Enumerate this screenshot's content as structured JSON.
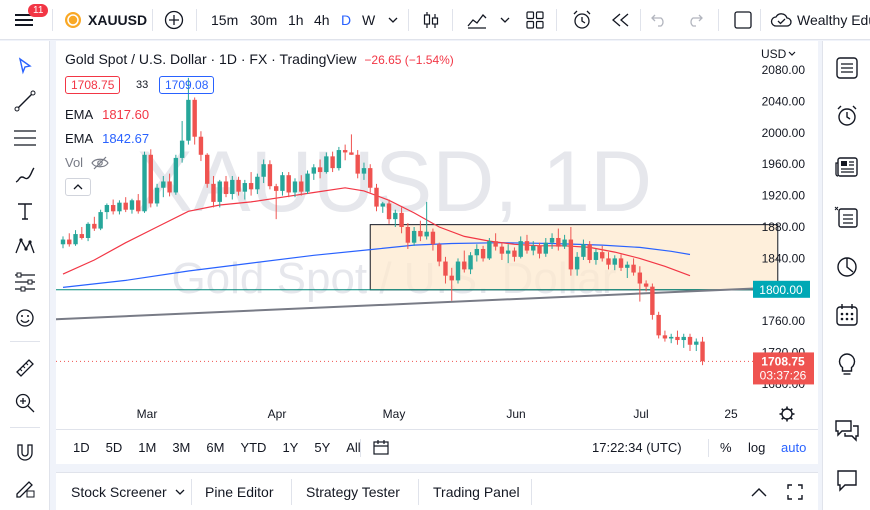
{
  "topbar": {
    "notification_count": "11",
    "symbol": "XAUUSD",
    "intervals": [
      "15m",
      "30m",
      "1h",
      "4h",
      "D",
      "W"
    ],
    "active_interval": "D",
    "account_name": "Wealthy Edu"
  },
  "legend": {
    "title": "Gold Spot / U.S. Dollar · 1D · FX · TradingView",
    "change": "−26.65 (−1.54%)",
    "bid": "1708.75",
    "spread": "33",
    "ask": "1709.08",
    "ema1_label": "EMA",
    "ema1_value": "1817.60",
    "ema2_label": "EMA",
    "ema2_value": "1842.67",
    "vol_label": "Vol"
  },
  "watermark": {
    "symbol": "XAUUSD, 1D",
    "name": "Gold Spot / U.S. Dollar"
  },
  "price_axis": {
    "currency": "USD",
    "ticks": [
      "2080.00",
      "2040.00",
      "2000.00",
      "1960.00",
      "1920.00",
      "1880.00",
      "1840.00",
      "1800.00",
      "1760.00",
      "1720.00",
      "1680.00"
    ],
    "highlighted_level": "1800.00",
    "last_price": "1708.75",
    "countdown": "03:37:26"
  },
  "time_axis": {
    "labels": [
      "Mar",
      "Apr",
      "May",
      "Jun",
      "Jul",
      "25"
    ]
  },
  "range_bar": {
    "ranges": [
      "1D",
      "5D",
      "1M",
      "3M",
      "6M",
      "YTD",
      "1Y",
      "5Y",
      "All"
    ],
    "clock": "17:22:34 (UTC)",
    "percent": "%",
    "log": "log",
    "auto": "auto"
  },
  "bottom_tabs": [
    "Stock Screener",
    "Pine Editor",
    "Strategy Tester",
    "Trading Panel"
  ],
  "colors": {
    "up": "#26a69a",
    "down": "#ef5350",
    "ema_fast": "#f23645",
    "ema_slow": "#2962ff",
    "accent": "#2962ff",
    "zone_fill": "#fde9cf",
    "zone_border": "#131722",
    "hline": "#00897b"
  },
  "chart_data": {
    "type": "candlestick",
    "instrument": "XAUUSD",
    "timeframe": "1D",
    "y_range": [
      1680,
      2085
    ],
    "candles": [
      {
        "o": 1858,
        "h": 1868,
        "l": 1853,
        "c": 1864
      },
      {
        "o": 1864,
        "h": 1872,
        "l": 1855,
        "c": 1858
      },
      {
        "o": 1858,
        "h": 1876,
        "l": 1856,
        "c": 1871
      },
      {
        "o": 1871,
        "h": 1880,
        "l": 1864,
        "c": 1866
      },
      {
        "o": 1866,
        "h": 1886,
        "l": 1862,
        "c": 1884
      },
      {
        "o": 1884,
        "h": 1893,
        "l": 1875,
        "c": 1878
      },
      {
        "o": 1878,
        "h": 1902,
        "l": 1876,
        "c": 1899
      },
      {
        "o": 1899,
        "h": 1910,
        "l": 1890,
        "c": 1908
      },
      {
        "o": 1908,
        "h": 1915,
        "l": 1896,
        "c": 1900
      },
      {
        "o": 1900,
        "h": 1914,
        "l": 1896,
        "c": 1911
      },
      {
        "o": 1911,
        "h": 1918,
        "l": 1899,
        "c": 1902
      },
      {
        "o": 1902,
        "h": 1916,
        "l": 1897,
        "c": 1914
      },
      {
        "o": 1914,
        "h": 1922,
        "l": 1897,
        "c": 1900
      },
      {
        "o": 1900,
        "h": 1976,
        "l": 1898,
        "c": 1972
      },
      {
        "o": 1972,
        "h": 1979,
        "l": 1905,
        "c": 1910
      },
      {
        "o": 1910,
        "h": 1935,
        "l": 1906,
        "c": 1930
      },
      {
        "o": 1930,
        "h": 1945,
        "l": 1918,
        "c": 1938
      },
      {
        "o": 1938,
        "h": 1948,
        "l": 1919,
        "c": 1924
      },
      {
        "o": 1924,
        "h": 1972,
        "l": 1921,
        "c": 1968
      },
      {
        "o": 1968,
        "h": 2015,
        "l": 1962,
        "c": 1990
      },
      {
        "o": 1990,
        "h": 2070,
        "l": 1985,
        "c": 2042
      },
      {
        "o": 2042,
        "h": 2045,
        "l": 1985,
        "c": 1995
      },
      {
        "o": 1995,
        "h": 2002,
        "l": 1964,
        "c": 1972
      },
      {
        "o": 1972,
        "h": 1974,
        "l": 1930,
        "c": 1935
      },
      {
        "o": 1935,
        "h": 1945,
        "l": 1905,
        "c": 1912
      },
      {
        "o": 1912,
        "h": 1940,
        "l": 1905,
        "c": 1938
      },
      {
        "o": 1938,
        "h": 1945,
        "l": 1918,
        "c": 1922
      },
      {
        "o": 1922,
        "h": 1945,
        "l": 1915,
        "c": 1940
      },
      {
        "o": 1940,
        "h": 1944,
        "l": 1920,
        "c": 1925
      },
      {
        "o": 1925,
        "h": 1940,
        "l": 1915,
        "c": 1936
      },
      {
        "o": 1936,
        "h": 1950,
        "l": 1920,
        "c": 1928
      },
      {
        "o": 1928,
        "h": 1948,
        "l": 1922,
        "c": 1944
      },
      {
        "o": 1944,
        "h": 1966,
        "l": 1936,
        "c": 1960
      },
      {
        "o": 1960,
        "h": 1965,
        "l": 1928,
        "c": 1932
      },
      {
        "o": 1932,
        "h": 1935,
        "l": 1890,
        "c": 1926
      },
      {
        "o": 1926,
        "h": 1950,
        "l": 1920,
        "c": 1946
      },
      {
        "o": 1946,
        "h": 1950,
        "l": 1918,
        "c": 1924
      },
      {
        "o": 1924,
        "h": 1942,
        "l": 1918,
        "c": 1938
      },
      {
        "o": 1938,
        "h": 1946,
        "l": 1920,
        "c": 1925
      },
      {
        "o": 1925,
        "h": 1952,
        "l": 1922,
        "c": 1948
      },
      {
        "o": 1948,
        "h": 1960,
        "l": 1940,
        "c": 1956
      },
      {
        "o": 1956,
        "h": 1966,
        "l": 1942,
        "c": 1950
      },
      {
        "o": 1950,
        "h": 1975,
        "l": 1948,
        "c": 1970
      },
      {
        "o": 1970,
        "h": 1976,
        "l": 1950,
        "c": 1955
      },
      {
        "o": 1955,
        "h": 1982,
        "l": 1952,
        "c": 1978
      },
      {
        "o": 1978,
        "h": 1985,
        "l": 1965,
        "c": 1975
      },
      {
        "o": 1975,
        "h": 1998,
        "l": 1972,
        "c": 1972
      },
      {
        "o": 1972,
        "h": 1978,
        "l": 1942,
        "c": 1948
      },
      {
        "o": 1948,
        "h": 1962,
        "l": 1940,
        "c": 1955
      },
      {
        "o": 1955,
        "h": 1960,
        "l": 1924,
        "c": 1930
      },
      {
        "o": 1930,
        "h": 1935,
        "l": 1900,
        "c": 1906
      },
      {
        "o": 1906,
        "h": 1912,
        "l": 1898,
        "c": 1910
      },
      {
        "o": 1910,
        "h": 1915,
        "l": 1884,
        "c": 1890
      },
      {
        "o": 1890,
        "h": 1902,
        "l": 1880,
        "c": 1898
      },
      {
        "o": 1898,
        "h": 1905,
        "l": 1872,
        "c": 1880
      },
      {
        "o": 1880,
        "h": 1885,
        "l": 1852,
        "c": 1860
      },
      {
        "o": 1860,
        "h": 1880,
        "l": 1856,
        "c": 1875
      },
      {
        "o": 1875,
        "h": 1888,
        "l": 1862,
        "c": 1868
      },
      {
        "o": 1868,
        "h": 1912,
        "l": 1864,
        "c": 1874
      },
      {
        "o": 1874,
        "h": 1878,
        "l": 1850,
        "c": 1858
      },
      {
        "o": 1858,
        "h": 1860,
        "l": 1830,
        "c": 1836
      },
      {
        "o": 1836,
        "h": 1842,
        "l": 1808,
        "c": 1818
      },
      {
        "o": 1818,
        "h": 1828,
        "l": 1786,
        "c": 1812
      },
      {
        "o": 1812,
        "h": 1840,
        "l": 1808,
        "c": 1836
      },
      {
        "o": 1836,
        "h": 1850,
        "l": 1822,
        "c": 1826
      },
      {
        "o": 1826,
        "h": 1848,
        "l": 1820,
        "c": 1844
      },
      {
        "o": 1844,
        "h": 1858,
        "l": 1836,
        "c": 1852
      },
      {
        "o": 1852,
        "h": 1856,
        "l": 1836,
        "c": 1840
      },
      {
        "o": 1840,
        "h": 1866,
        "l": 1838,
        "c": 1862
      },
      {
        "o": 1862,
        "h": 1872,
        "l": 1850,
        "c": 1855
      },
      {
        "o": 1855,
        "h": 1860,
        "l": 1838,
        "c": 1846
      },
      {
        "o": 1846,
        "h": 1858,
        "l": 1834,
        "c": 1850
      },
      {
        "o": 1850,
        "h": 1854,
        "l": 1836,
        "c": 1842
      },
      {
        "o": 1842,
        "h": 1868,
        "l": 1840,
        "c": 1862
      },
      {
        "o": 1862,
        "h": 1870,
        "l": 1846,
        "c": 1850
      },
      {
        "o": 1850,
        "h": 1862,
        "l": 1844,
        "c": 1856
      },
      {
        "o": 1856,
        "h": 1860,
        "l": 1840,
        "c": 1846
      },
      {
        "o": 1846,
        "h": 1866,
        "l": 1842,
        "c": 1860
      },
      {
        "o": 1860,
        "h": 1872,
        "l": 1852,
        "c": 1866
      },
      {
        "o": 1866,
        "h": 1878,
        "l": 1850,
        "c": 1855
      },
      {
        "o": 1855,
        "h": 1870,
        "l": 1852,
        "c": 1864
      },
      {
        "o": 1864,
        "h": 1880,
        "l": 1818,
        "c": 1826
      },
      {
        "o": 1826,
        "h": 1848,
        "l": 1818,
        "c": 1842
      },
      {
        "o": 1842,
        "h": 1864,
        "l": 1838,
        "c": 1858
      },
      {
        "o": 1858,
        "h": 1862,
        "l": 1834,
        "c": 1838
      },
      {
        "o": 1838,
        "h": 1852,
        "l": 1832,
        "c": 1848
      },
      {
        "o": 1848,
        "h": 1856,
        "l": 1836,
        "c": 1840
      },
      {
        "o": 1840,
        "h": 1848,
        "l": 1826,
        "c": 1832
      },
      {
        "o": 1832,
        "h": 1844,
        "l": 1825,
        "c": 1840
      },
      {
        "o": 1840,
        "h": 1845,
        "l": 1824,
        "c": 1828
      },
      {
        "o": 1828,
        "h": 1836,
        "l": 1815,
        "c": 1832
      },
      {
        "o": 1832,
        "h": 1840,
        "l": 1818,
        "c": 1822
      },
      {
        "o": 1822,
        "h": 1830,
        "l": 1785,
        "c": 1808
      },
      {
        "o": 1808,
        "h": 1812,
        "l": 1798,
        "c": 1804
      },
      {
        "o": 1804,
        "h": 1808,
        "l": 1762,
        "c": 1768
      },
      {
        "o": 1768,
        "h": 1772,
        "l": 1738,
        "c": 1742
      },
      {
        "o": 1742,
        "h": 1748,
        "l": 1734,
        "c": 1738
      },
      {
        "o": 1738,
        "h": 1744,
        "l": 1732,
        "c": 1740
      },
      {
        "o": 1740,
        "h": 1748,
        "l": 1730,
        "c": 1736
      },
      {
        "o": 1736,
        "h": 1744,
        "l": 1726,
        "c": 1740
      },
      {
        "o": 1740,
        "h": 1744,
        "l": 1722,
        "c": 1730
      },
      {
        "o": 1730,
        "h": 1738,
        "l": 1722,
        "c": 1734
      },
      {
        "o": 1734,
        "h": 1740,
        "l": 1704,
        "c": 1709
      }
    ],
    "ema_fast": [
      [
        0,
        1820
      ],
      [
        5,
        1838
      ],
      [
        10,
        1860
      ],
      [
        15,
        1880
      ],
      [
        20,
        1900
      ],
      [
        25,
        1908
      ],
      [
        30,
        1912
      ],
      [
        35,
        1918
      ],
      [
        40,
        1924
      ],
      [
        45,
        1930
      ],
      [
        48,
        1926
      ],
      [
        52,
        1914
      ],
      [
        56,
        1898
      ],
      [
        60,
        1880
      ],
      [
        64,
        1868
      ],
      [
        68,
        1862
      ],
      [
        72,
        1858
      ],
      [
        76,
        1856
      ],
      [
        80,
        1856
      ],
      [
        84,
        1854
      ],
      [
        88,
        1848
      ],
      [
        92,
        1840
      ],
      [
        96,
        1830
      ],
      [
        100,
        1818
      ]
    ],
    "ema_slow": [
      [
        0,
        1803
      ],
      [
        10,
        1812
      ],
      [
        20,
        1824
      ],
      [
        30,
        1834
      ],
      [
        40,
        1844
      ],
      [
        50,
        1852
      ],
      [
        56,
        1857
      ],
      [
        62,
        1859
      ],
      [
        70,
        1860
      ],
      [
        78,
        1859
      ],
      [
        86,
        1857
      ],
      [
        92,
        1854
      ],
      [
        97,
        1849
      ],
      [
        100,
        1845
      ]
    ],
    "horizontal_line": 1800,
    "trendline": [
      [
        -8,
        1760
      ],
      [
        114,
        1803
      ]
    ],
    "rectangle": {
      "x_start": 49,
      "x_end": 114,
      "top": 1883,
      "bottom": 1800
    },
    "last_price_line": 1708.75
  }
}
